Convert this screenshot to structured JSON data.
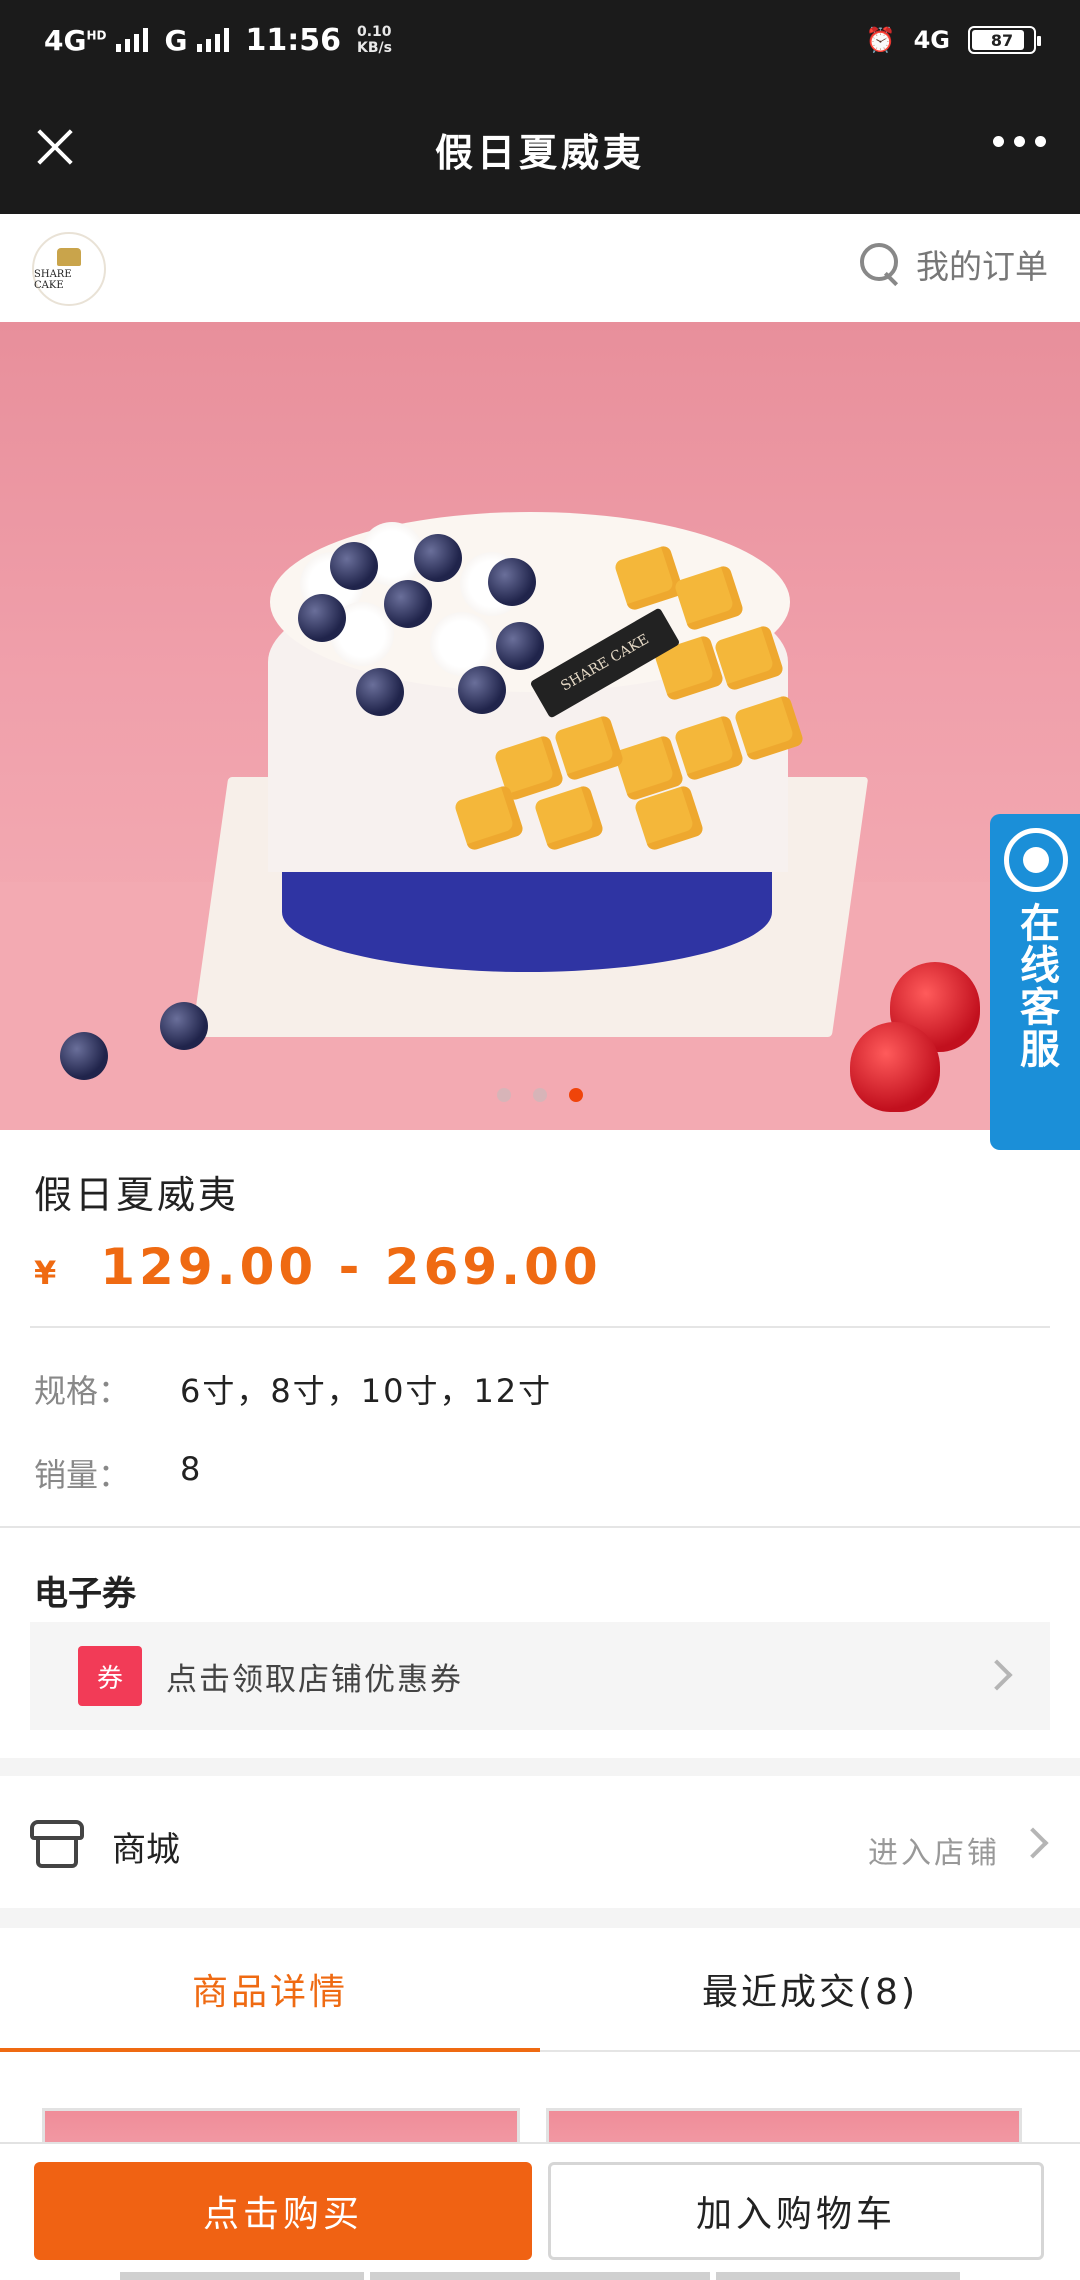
{
  "status_bar": {
    "network_left": "4G",
    "network_hd": "HD",
    "network_g": "G",
    "time": "11:56",
    "net_speed_value": "0.10",
    "net_speed_unit": "KB/s",
    "network_right": "4G",
    "battery": "87"
  },
  "title_bar": {
    "title": "假日夏威夷"
  },
  "store": {
    "logo_text": "SHARE CAKE",
    "orders_label": "我的订单"
  },
  "hero": {
    "plaque_text": "SHARE CAKE",
    "slide_count": 3,
    "active_slide": 3
  },
  "service": {
    "label": "在线客服"
  },
  "product": {
    "name": "假日夏威夷",
    "currency": "¥",
    "price_range": "129.00 - 269.00",
    "spec_label": "规格：",
    "spec_value": "6寸，8寸，10寸，12寸",
    "sales_label": "销量：",
    "sales_value": "8"
  },
  "coupon": {
    "section_title": "电子券",
    "tag": "券",
    "text": "点击领取店铺优惠券"
  },
  "shop": {
    "label": "商城",
    "enter_label": "进入店铺"
  },
  "tabs": [
    {
      "label": "商品详情",
      "active": true
    },
    {
      "label": "最近成交(8)",
      "active": false
    }
  ],
  "bottom": {
    "buy_label": "点击购买",
    "cart_label": "加入购物车"
  },
  "colors": {
    "accent": "#ef6a12",
    "buy_button": "#f06213",
    "service": "#1b8fd8",
    "coupon_tag": "#f23b57"
  }
}
